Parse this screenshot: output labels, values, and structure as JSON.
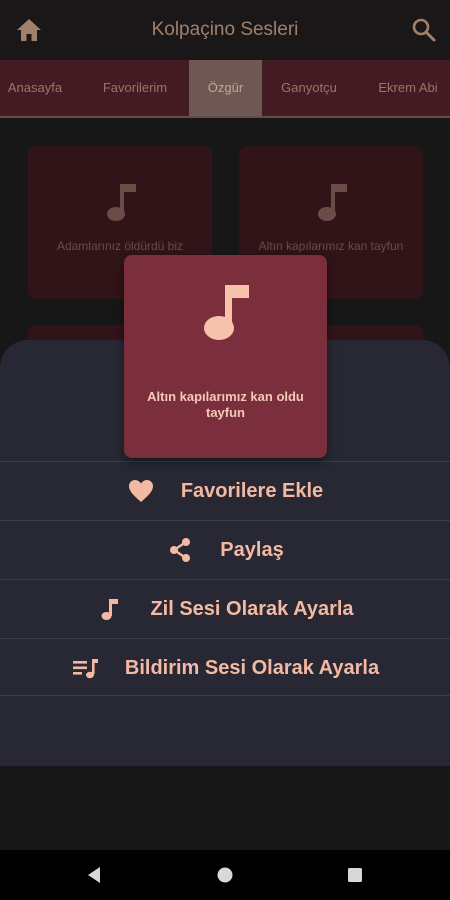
{
  "app_bar": {
    "title": "Kolpaçino Sesleri",
    "home_icon": "home-icon",
    "search_icon": "search-icon"
  },
  "tabs": [
    {
      "label": "Anasayfa",
      "active": false
    },
    {
      "label": "Favorilerim",
      "active": false
    },
    {
      "label": "Özgür",
      "active": true
    },
    {
      "label": "Ganyotçu",
      "active": false
    },
    {
      "label": "Ekrem Abi",
      "active": false
    }
  ],
  "grid_cards": [
    {
      "label": "Adamlarınız öldürdü biz",
      "icon": "music-note-icon"
    },
    {
      "label": "Altın kapılarımız kan tayfun",
      "icon": "music-note-icon"
    }
  ],
  "preview_card": {
    "label": "Altın kapılarımız kan oldu tayfun",
    "icon": "music-note-icon"
  },
  "sheet_actions": [
    {
      "label": "Favorilere Ekle",
      "icon": "heart-icon"
    },
    {
      "label": "Paylaş",
      "icon": "share-icon"
    },
    {
      "label": "Zil Sesi Olarak Ayarla",
      "icon": "music-note-icon"
    },
    {
      "label": "Bildirim Sesi Olarak Ayarla",
      "icon": "playlist-icon"
    }
  ],
  "nav_bar": {
    "back_icon": "back-icon",
    "home_icon": "home-circle-icon",
    "recents_icon": "recents-icon"
  },
  "colors": {
    "app_bar_bg": "#1a1718",
    "tab_bg": "#421c22",
    "tab_active_bg": "#6e5853",
    "sheet_bg": "#272833",
    "preview_bg": "#7b2f3d",
    "accent_text": "#f4b9a2"
  }
}
